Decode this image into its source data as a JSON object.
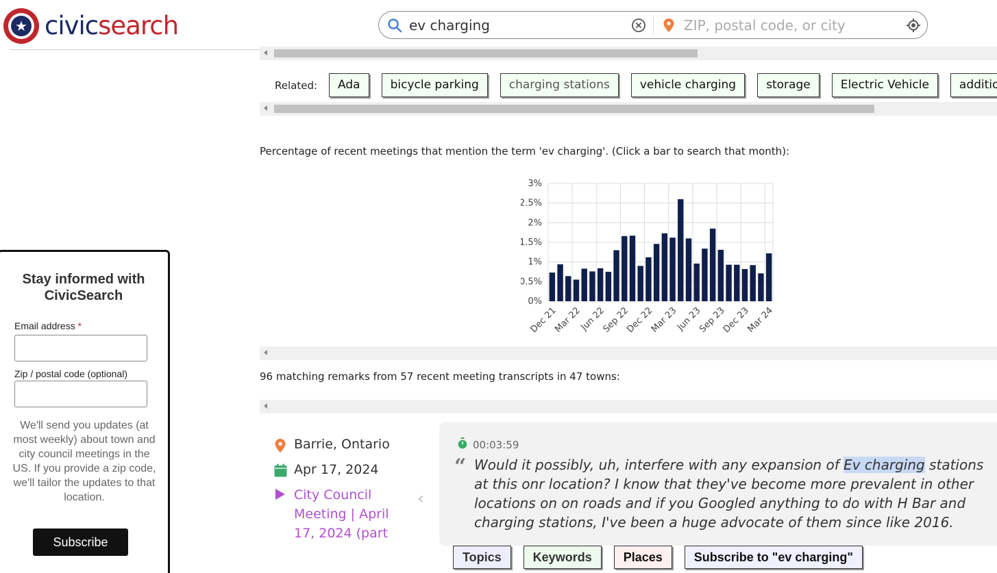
{
  "logo": {
    "civic": "civic",
    "search": "search"
  },
  "search": {
    "query": "ev charging",
    "location_placeholder": "ZIP, postal code, or city"
  },
  "related": {
    "label": "Related:",
    "chips": [
      "Ada",
      "bicycle parking",
      "charging stations",
      "vehicle charging",
      "storage",
      "Electric Vehicle",
      "additional"
    ]
  },
  "chart_caption": "Percentage of recent meetings that mention the term 'ev charging'. (Click a bar to search that month):",
  "chart_data": {
    "type": "bar",
    "title": "",
    "xlabel": "",
    "ylabel": "",
    "ylim": [
      0,
      3
    ],
    "yticks": [
      "0%",
      "0.5%",
      "1%",
      "1.5%",
      "2%",
      "2.5%",
      "3%"
    ],
    "xtick_labels": [
      "Dec 21",
      "Mar 22",
      "Jun 22",
      "Sep 22",
      "Dec 22",
      "Mar 23",
      "Jun 23",
      "Sep 23",
      "Dec 23",
      "Mar 24"
    ],
    "categories": [
      "Dec 21",
      "Jan 22",
      "Feb 22",
      "Mar 22",
      "Apr 22",
      "May 22",
      "Jun 22",
      "Jul 22",
      "Aug 22",
      "Sep 22",
      "Oct 22",
      "Nov 22",
      "Dec 22",
      "Jan 23",
      "Feb 23",
      "Mar 23",
      "Apr 23",
      "May 23",
      "Jun 23",
      "Jul 23",
      "Aug 23",
      "Sep 23",
      "Oct 23",
      "Nov 23",
      "Dec 23",
      "Jan 24",
      "Feb 24",
      "Mar 24",
      "Apr 24"
    ],
    "values": [
      0.73,
      0.94,
      0.64,
      0.55,
      0.83,
      0.76,
      0.84,
      0.75,
      1.3,
      1.66,
      1.67,
      0.9,
      1.12,
      1.46,
      1.73,
      1.62,
      2.6,
      1.6,
      0.96,
      1.34,
      1.85,
      1.31,
      0.93,
      0.93,
      0.82,
      0.92,
      0.71,
      1.22
    ],
    "grid": true,
    "bar_color": "#0f1f4d"
  },
  "summary": "96 matching remarks from 57 recent meeting transcripts in 47 towns:",
  "signup": {
    "title": "Stay informed with CivicSearch",
    "email_label": "Email address",
    "required_mark": "*",
    "zip_label": "Zip / postal code (optional)",
    "note": "We'll send you updates (at most weekly) about town and city council meetings in the US. If you provide a zip code, we'll tailor the updates to that location.",
    "button": "Subscribe"
  },
  "result": {
    "place": "Barrie, Ontario",
    "date": "Apr 17, 2024",
    "meeting": "City Council Meeting | April 17, 2024 (part",
    "timestamp": "00:03:59",
    "quote_before": "Would it possibly, uh, interfere with any expansion of ",
    "quote_highlight": "Ev charging",
    "quote_after": " stations at this onr location? I know that they've become more prevalent in other locations on on roads and if you Googled anything to do with H Bar and charging stations, I've been a huge advocate of them since like 2016."
  },
  "tabs": {
    "topics": "Topics",
    "keywords": "Keywords",
    "places": "Places",
    "subscribe": "Subscribe to \"ev charging\""
  },
  "colors": {
    "brand_red": "#c0272d",
    "brand_navy": "#1b2a63",
    "link_purple": "#b14fcf"
  }
}
